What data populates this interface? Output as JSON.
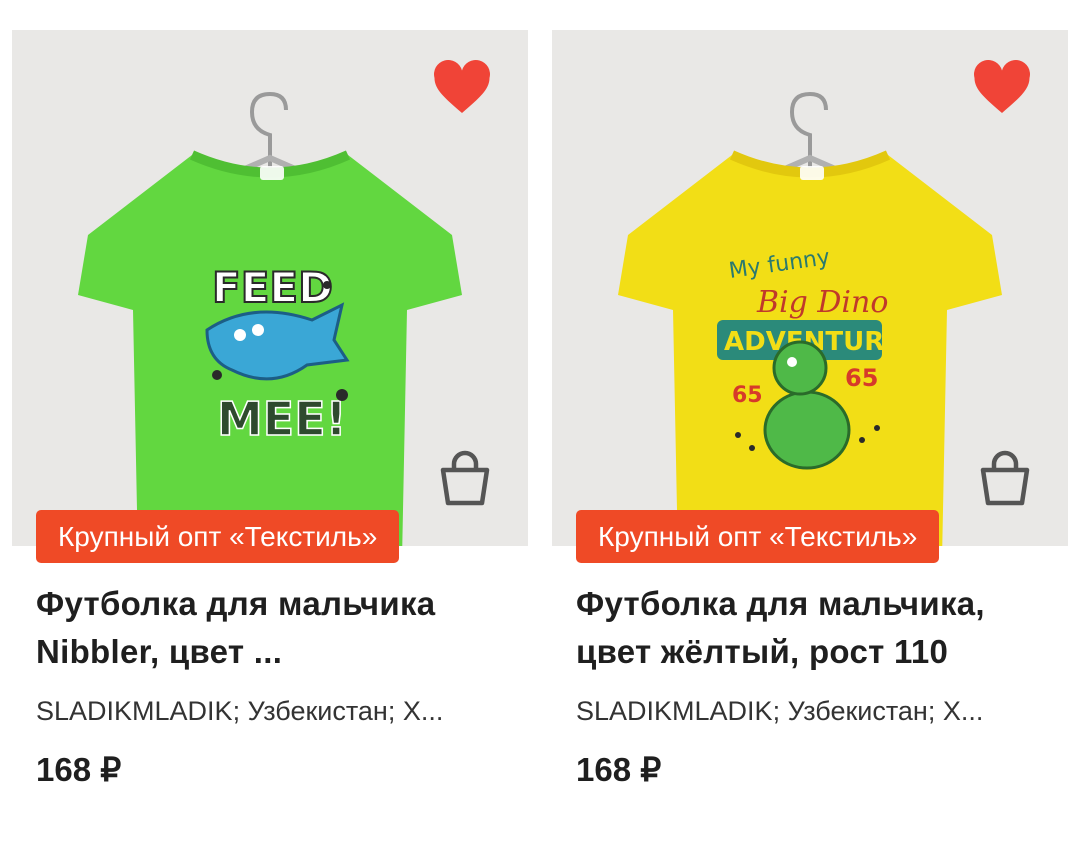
{
  "colors": {
    "badge": "#ef4a26",
    "heart": "#f04437",
    "text": "#1f1f1f"
  },
  "products": [
    {
      "image_desc_icon": "tshirt-green-shark",
      "shirt_color": "#62d740",
      "print_text_top": "FEED",
      "print_text_bottom": "MEE!",
      "badge": "Крупный опт «Текстиль»",
      "title": "Футболка для мальчика Nibbler, цвет ...",
      "meta": "SLADIKMLADIK; Узбекистан; Х...",
      "price": "168 ₽",
      "favorite": true
    },
    {
      "image_desc_icon": "tshirt-yellow-dino",
      "shirt_color": "#f2de16",
      "print_text_top": "My funny Big Dino",
      "print_text_bottom": "ADVENTURE",
      "badge": "Крупный опт «Текстиль»",
      "title": "Футболка для мальчика, цвет жёлтый, рост 110",
      "meta": "SLADIKMLADIK; Узбекистан; Х...",
      "price": "168 ₽",
      "favorite": true
    }
  ]
}
